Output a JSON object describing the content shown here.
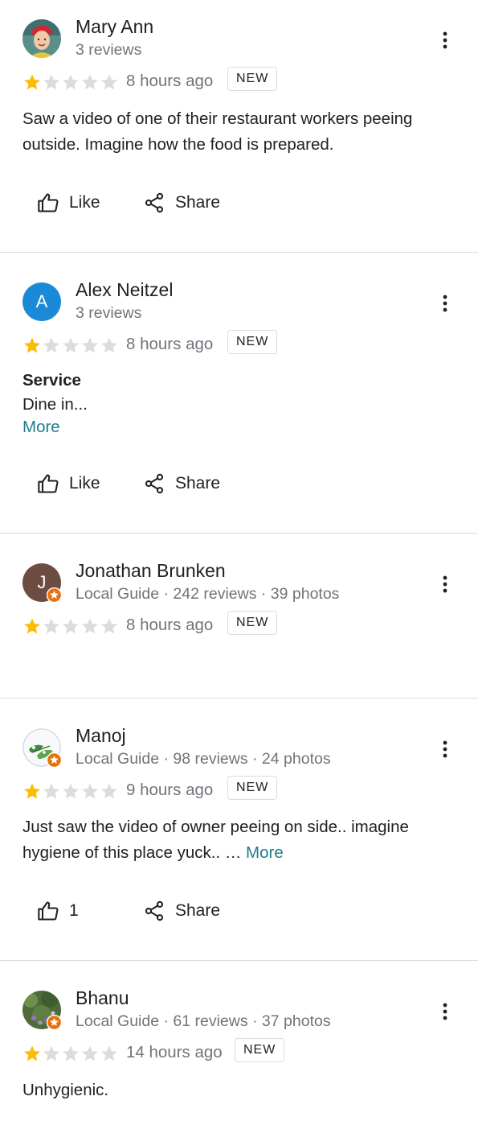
{
  "reviews": [
    {
      "name": "Mary Ann",
      "meta": "3 reviews",
      "rating": 1,
      "time": "8 hours ago",
      "badge": "NEW",
      "text": "Saw a video of one of their restaurant workers peeing outside. Imagine how the food is prepared.",
      "actions": {
        "like": "Like",
        "share": "Share"
      }
    },
    {
      "name": "Alex Neitzel",
      "meta": "3 reviews",
      "avatar_letter": "A",
      "avatar_color": "#1a8ad6",
      "rating": 1,
      "time": "8 hours ago",
      "badge": "NEW",
      "heading": "Service",
      "text": "Dine in...",
      "more": "More",
      "actions": {
        "like": "Like",
        "share": "Share"
      }
    },
    {
      "name": "Jonathan Brunken",
      "meta": "Local Guide · 242 reviews · 39 photos",
      "avatar_letter": "J",
      "avatar_color": "#6d4c41",
      "rating": 1,
      "time": "8 hours ago",
      "badge": "NEW"
    },
    {
      "name": "Manoj",
      "meta": "Local Guide · 98 reviews · 24 photos",
      "rating": 1,
      "time": "9 hours ago",
      "badge": "NEW",
      "text_line1": "Just saw the video of owner peeing on side.. imagine",
      "text_line2": "hygiene of this place yuck.. …",
      "more": "More",
      "actions": {
        "like_count": "1",
        "share": "Share"
      }
    },
    {
      "name": "Bhanu",
      "meta": "Local Guide · 61 reviews · 37 photos",
      "rating": 1,
      "time": "14 hours ago",
      "badge": "NEW",
      "text": "Unhygienic."
    }
  ],
  "colors": {
    "star_filled": "#fbbc04",
    "star_empty": "#dadce0",
    "local_guide_badge": "#e8710a",
    "link": "#1d7f8c"
  },
  "icons": [
    "more-vert-icon",
    "thumb-up-icon",
    "share-icon",
    "star-icon",
    "local-guide-badge-icon"
  ]
}
